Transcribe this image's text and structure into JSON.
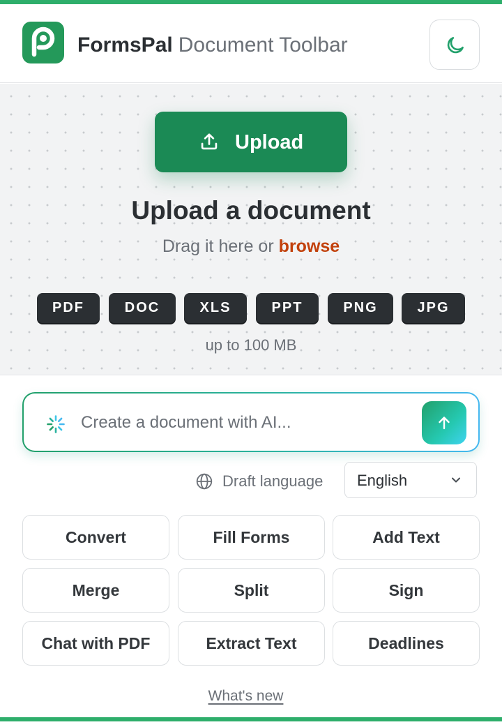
{
  "header": {
    "brand_name": "FormsPal",
    "brand_subtitle": "Document Toolbar",
    "logo_icon": "formspal-p-logo",
    "theme_toggle_icon": "moon-icon"
  },
  "upload": {
    "button_label": "Upload",
    "title": "Upload a document",
    "subtitle_prefix": "Drag it here or",
    "browse_label": "browse",
    "formats": [
      "PDF",
      "DOC",
      "XLS",
      "PPT",
      "PNG",
      "JPG"
    ],
    "size_limit": "up to 100 MB"
  },
  "ai": {
    "placeholder": "Create a document with AI...",
    "value": "",
    "send_icon": "arrow-up-icon"
  },
  "language": {
    "label": "Draft language",
    "selected": "English"
  },
  "tools": [
    "Convert",
    "Fill Forms",
    "Add Text",
    "Merge",
    "Split",
    "Sign",
    "Chat with PDF",
    "Extract Text",
    "Deadlines"
  ],
  "footer": {
    "whats_new": "What's new"
  },
  "colors": {
    "brand_green": "#24995a",
    "upload_green": "#1b8a55",
    "browse_orange": "#c2410c",
    "chip_dark": "#2b2f33"
  }
}
